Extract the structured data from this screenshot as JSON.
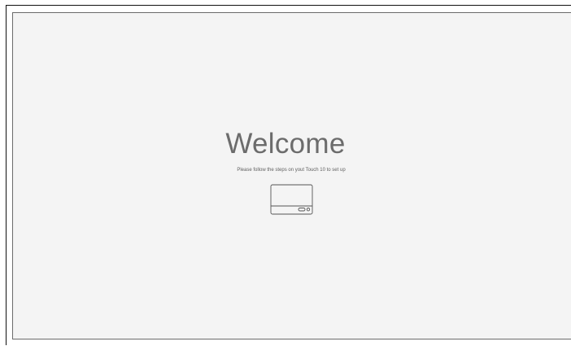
{
  "welcome": {
    "title": "Welcome",
    "subtitle": "Please follow the steps on yout Touch 10 to set up",
    "icon": "touch-10-device-icon"
  },
  "colors": {
    "screen_background": "#f4f4f4",
    "title_text": "#6c6c6c",
    "frame_border": "#111111"
  }
}
